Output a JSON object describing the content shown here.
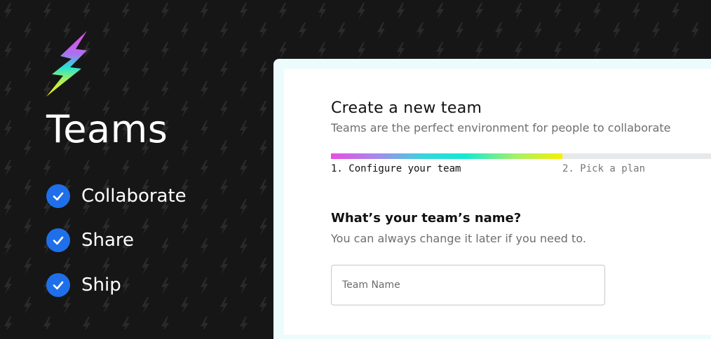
{
  "brand": {
    "title": "Teams",
    "logo_icon": "lightning-bolt-icon"
  },
  "features": [
    {
      "label": "Collaborate",
      "icon": "check-circle-icon"
    },
    {
      "label": "Share",
      "icon": "check-circle-icon"
    },
    {
      "label": "Ship",
      "icon": "check-circle-icon"
    }
  ],
  "form": {
    "title": "Create a new team",
    "subtitle": "Teams are the perfect environment for people to collaborate",
    "progress": 0.59,
    "steps": [
      {
        "label": "1. Configure your team",
        "active": true
      },
      {
        "label": "2. Pick a plan",
        "active": false
      }
    ],
    "question": "What’s your team’s name?",
    "hint": "You can always change it later if you need to.",
    "team_name": {
      "value": "",
      "placeholder": "Team Name"
    }
  },
  "colors": {
    "background": "#161616",
    "check_badge": "#1f6feb",
    "progress_gradient": [
      "#e64ee4",
      "#3ad3de",
      "#14e9d0",
      "#f7f000"
    ]
  }
}
